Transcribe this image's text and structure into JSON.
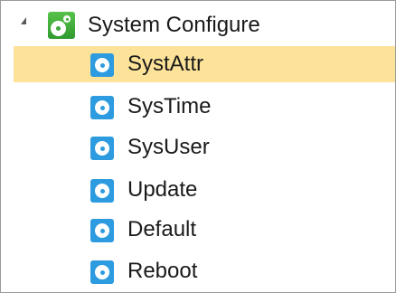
{
  "tree": {
    "root": {
      "label": "System Configure",
      "expanded": true,
      "icon": "gears-icon",
      "icon_color": "#3aa83a"
    },
    "children": [
      {
        "label": "SystAttr",
        "icon": "gear-icon",
        "selected": true
      },
      {
        "label": "SysTime",
        "icon": "gear-icon",
        "selected": false
      },
      {
        "label": "SysUser",
        "icon": "gear-icon",
        "selected": false
      },
      {
        "label": "Update",
        "icon": "gear-icon",
        "selected": false
      },
      {
        "label": "Default",
        "icon": "gear-icon",
        "selected": false
      },
      {
        "label": "Reboot",
        "icon": "gear-icon",
        "selected": false
      }
    ],
    "colors": {
      "child_icon": "#2d9be0",
      "selection_highlight": "#fde399"
    }
  }
}
